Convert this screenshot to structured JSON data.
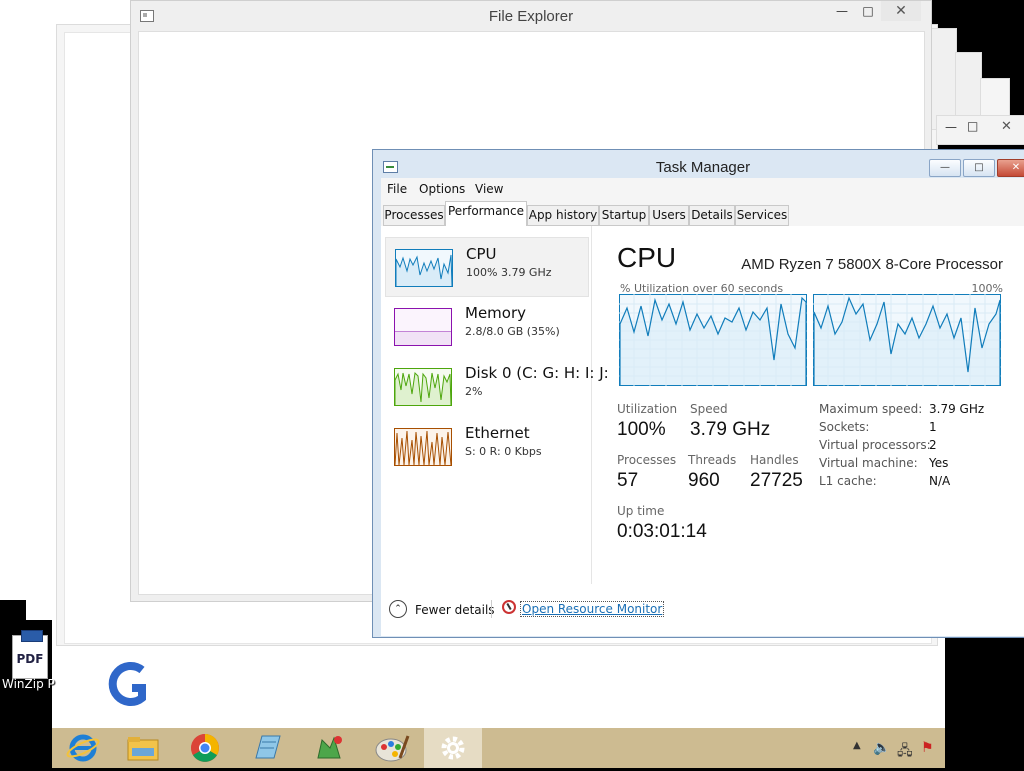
{
  "file_explorer": {
    "title": "File Explorer",
    "minimize": "—",
    "maximize": "□",
    "close": "✕"
  },
  "task_manager": {
    "title": "Task Manager",
    "menu": [
      "File",
      "Options",
      "View"
    ],
    "tabs": [
      "Processes",
      "Performance",
      "App history",
      "Startup",
      "Users",
      "Details",
      "Services"
    ],
    "active_tab": "Performance",
    "resources": [
      {
        "name": "CPU",
        "sub": "100%  3.79 GHz",
        "color": "#117dbb"
      },
      {
        "name": "Memory",
        "sub": "2.8/8.0 GB (35%)",
        "color": "#8b12ae"
      },
      {
        "name": "Disk 0 (C: G: H: I: J:",
        "sub": "2%",
        "color": "#4da60c"
      },
      {
        "name": "Ethernet",
        "sub": "S: 0 R: 0 Kbps",
        "color": "#a74f01"
      }
    ],
    "cpu": {
      "heading": "CPU",
      "model": "AMD Ryzen 7 5800X 8-Core Processor",
      "graph_label": "% Utilization over 60 seconds",
      "graph_max": "100%",
      "utilization_label": "Utilization",
      "utilization": "100%",
      "speed_label": "Speed",
      "speed": "3.79 GHz",
      "processes_label": "Processes",
      "processes": "57",
      "threads_label": "Threads",
      "threads": "960",
      "handles_label": "Handles",
      "handles": "27725",
      "uptime_label": "Up time",
      "uptime": "0:03:01:14",
      "specs": [
        {
          "key": "Maximum speed:",
          "value": "3.79 GHz"
        },
        {
          "key": "Sockets:",
          "value": "1"
        },
        {
          "key": "Virtual processors:",
          "value": "2"
        },
        {
          "key": "Virtual machine:",
          "value": "Yes"
        },
        {
          "key": "L1 cache:",
          "value": "N/A"
        }
      ]
    },
    "footer": {
      "fewer_details": "Fewer details",
      "resource_monitor": "Open Resource Monitor"
    }
  },
  "desktop": {
    "icon_label": "WinZip P",
    "pdf_text": "PDF"
  },
  "taskbar": {
    "apps": [
      "internet-explorer",
      "file-explorer",
      "chrome",
      "notepad",
      "winzip-app",
      "paint",
      "task-manager"
    ],
    "color": "#cdbb91"
  }
}
